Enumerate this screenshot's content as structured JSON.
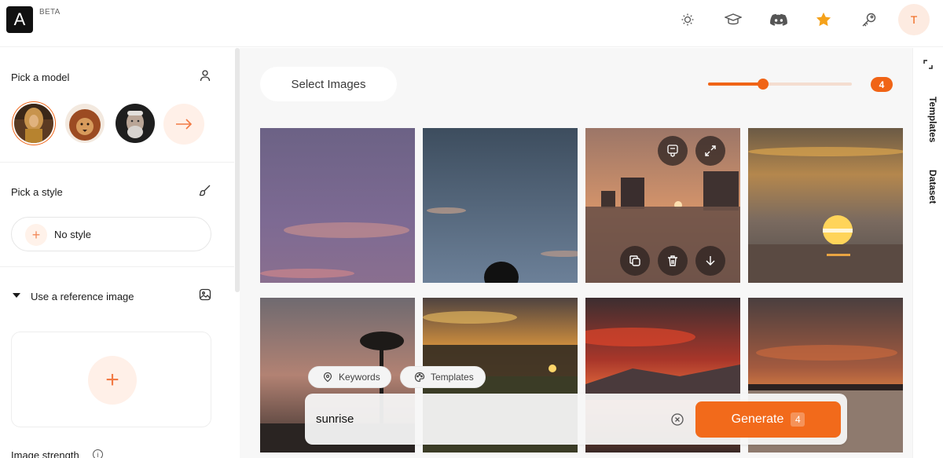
{
  "header": {
    "logo_letter": "A",
    "beta_label": "BETA",
    "icons": [
      "sun-icon",
      "graduation-cap-icon",
      "discord-icon",
      "star-icon",
      "key-icon"
    ],
    "avatar_initial": "T",
    "accent_color": "#f06416"
  },
  "sidebar": {
    "model_section": {
      "title": "Pick a model"
    },
    "style_section": {
      "title": "Pick a style",
      "no_style_label": "No style",
      "plus": "+"
    },
    "reference_section": {
      "title": "Use a reference image",
      "plus": "+"
    },
    "strength": {
      "label": "Image strength",
      "info": "i"
    }
  },
  "toolbar": {
    "select_images_label": "Select Images",
    "image_count_slider": 0.38,
    "image_count": "4"
  },
  "tags": {
    "keywords_label": "Keywords",
    "templates_label": "Templates"
  },
  "prompt": {
    "value": "sunrise",
    "generate_label": "Generate",
    "generate_count": "4"
  },
  "rail": {
    "tabs": [
      "Templates",
      "Dataset"
    ]
  }
}
